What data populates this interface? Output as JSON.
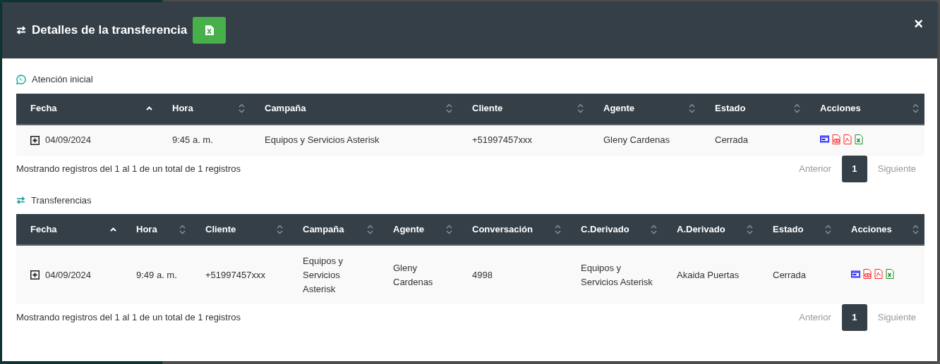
{
  "modal": {
    "title": "Detalles de la transferencia",
    "close": "×"
  },
  "sections": [
    {
      "heading": "Atención inicial",
      "columns": [
        {
          "label": "Fecha",
          "sorted": true
        },
        {
          "label": "Hora",
          "sorted": false
        },
        {
          "label": "Campaña",
          "sorted": false
        },
        {
          "label": "Cliente",
          "sorted": false
        },
        {
          "label": "Agente",
          "sorted": false
        },
        {
          "label": "Estado",
          "sorted": false
        },
        {
          "label": "Acciones",
          "sorted": false
        }
      ],
      "rows": [
        {
          "expanded": false,
          "cells": [
            "04/09/2024",
            "9:45 a. m.",
            "Equipos y Servicios Asterisk",
            "+51997457xxx",
            "Gleny Cardenas",
            "Cerrada"
          ]
        }
      ],
      "info": "Mostrando registros del 1 al 1 de un total de 1 registros",
      "pagination": {
        "previous": {
          "label": "Anterior",
          "disabled": true
        },
        "pages": [
          {
            "label": "1",
            "selected": true
          }
        ],
        "next": {
          "label": "Siguiente",
          "disabled": true
        }
      }
    },
    {
      "heading": "Transferencias",
      "columns": [
        {
          "label": "Fecha",
          "sorted": true
        },
        {
          "label": "Hora",
          "sorted": false
        },
        {
          "label": "Cliente",
          "sorted": false
        },
        {
          "label": "Campaña",
          "sorted": false
        },
        {
          "label": "Agente",
          "sorted": false
        },
        {
          "label": "Conversación",
          "sorted": false
        },
        {
          "label": "C.Derivado",
          "sorted": false
        },
        {
          "label": "A.Derivado",
          "sorted": false
        },
        {
          "label": "Estado",
          "sorted": false
        },
        {
          "label": "Acciones",
          "sorted": false
        }
      ],
      "rows": [
        {
          "expanded": false,
          "cells": [
            "04/09/2024",
            "9:49 a. m.",
            "+51997457xxx",
            "Equipos y Servicios Asterisk",
            "Gleny Cardenas",
            "4998",
            "Equipos y Servicios Asterisk",
            "Akaida Puertas",
            "Cerrada"
          ]
        }
      ],
      "info": "Mostrando registros del 1 al 1 de un total de 1 registros",
      "pagination": {
        "previous": {
          "label": "Anterior",
          "disabled": true
        },
        "pages": [
          {
            "label": "1",
            "selected": true
          }
        ],
        "next": {
          "label": "Siguiente",
          "disabled": true
        }
      }
    }
  ]
}
